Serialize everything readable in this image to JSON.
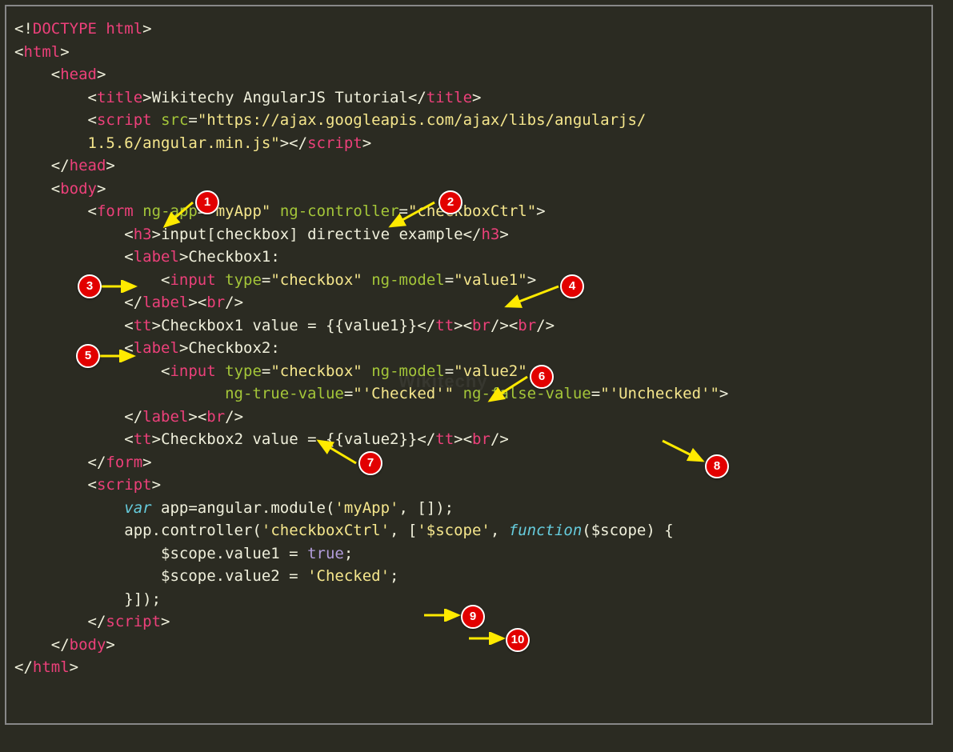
{
  "code": {
    "doctype_open": "<!",
    "doctype": "DOCTYPE html",
    "html_open": "html",
    "head_open": "head",
    "title_open": "title",
    "title_text": "Wikitechy AngularJS Tutorial",
    "title_close": "title",
    "script_open": "script",
    "src_attr": "src",
    "src_val": "\"https://ajax.googleapis.com/ajax/libs/angularjs/",
    "src_val2": "1.5.6/angular.min.js\"",
    "script_close": "script",
    "head_close": "head",
    "body_open": "body",
    "form_open": "form",
    "ngapp_attr": "ng-app",
    "ngapp_val": "\"myApp\"",
    "ngctrl_attr": "ng-controller",
    "ngctrl_val": "\"checkboxCtrl\"",
    "h3": "h3",
    "h3_text": "input[checkbox] directive example",
    "label": "label",
    "label1_text": "Checkbox1:",
    "input": "input",
    "type_attr": "type",
    "type_val": "\"checkbox\"",
    "ngmodel_attr": "ng-model",
    "ngmodel_val1": "\"value1\"",
    "br": "br",
    "tt": "tt",
    "tt1_text": "Checkbox1 value = {{value1}}",
    "label2_text": "Checkbox2:",
    "ngmodel_val2": "\"value2\"",
    "ngtrue_attr": "ng-true-value",
    "ngtrue_val": "\"'Checked'\"",
    "ngfalse_attr": "ng-false-value",
    "ngfalse_val": "\"'Unchecked'\"",
    "tt2_text": "Checkbox2 value = {{value2}}",
    "form_close": "form",
    "var_kw": "var",
    "app_line": " app=angular.module(",
    "myapp_str": "'myApp'",
    "app_line2": ", []);",
    "ctrl_line": "app.controller(",
    "ctrl_str": "'checkboxCtrl'",
    "scope_str": "'$scope'",
    "function_kw": "function",
    "scope_param": "($scope) {",
    "scope1_line": "$scope.value1 = ",
    "true_kw": "true",
    "semicolon": ";",
    "scope2_line": "$scope.value2 = ",
    "checked_str": "'Checked'",
    "close_arr": "}]);",
    "body_close": "body",
    "html_close": "html"
  },
  "badges": {
    "b1": "1",
    "b2": "2",
    "b3": "3",
    "b4": "4",
    "b5": "5",
    "b6": "6",
    "b7": "7",
    "b8": "8",
    "b9": "9",
    "b10": "10"
  },
  "watermark": "Wikitechy"
}
